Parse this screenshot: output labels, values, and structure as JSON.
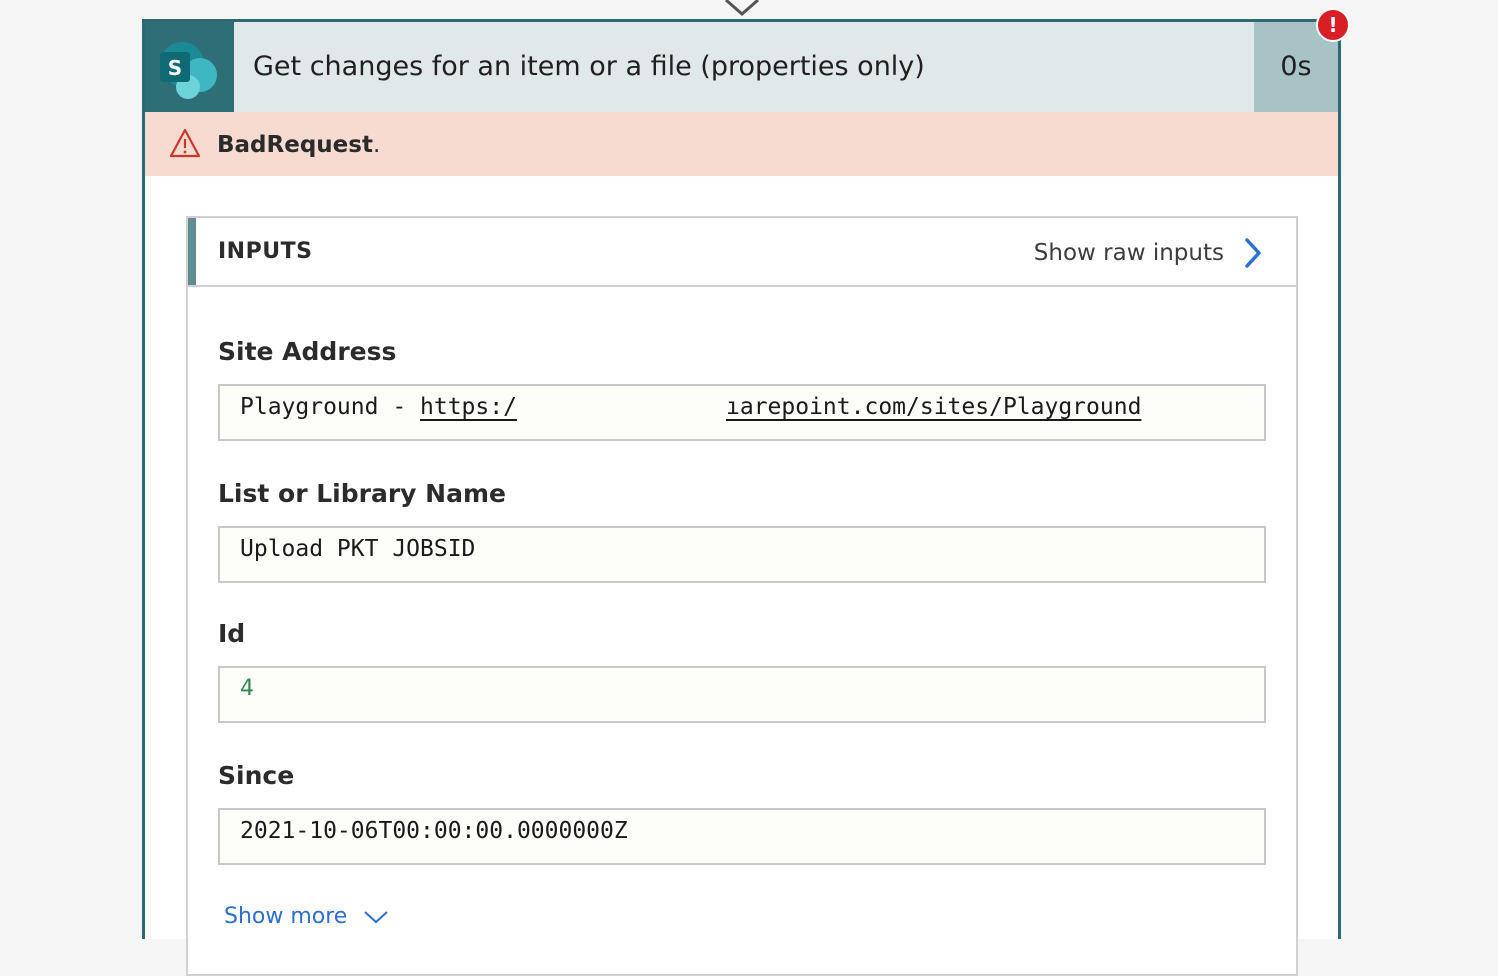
{
  "action": {
    "title": "Get changes for an item or a file (properties only)",
    "duration": "0s",
    "connector_icon": "sharepoint-icon",
    "status_icon": "error-icon",
    "status_glyph": "!"
  },
  "error": {
    "icon": "warning-icon",
    "code": "BadRequest",
    "suffix": "."
  },
  "inputs": {
    "title": "INPUTS",
    "raw_link_label": "Show raw inputs",
    "fields": [
      {
        "label": "Site Address",
        "value_prefix": "Playground - ",
        "value_url_start": "https:/",
        "value_url_end": "ıarepoint.com/sites/Playground"
      },
      {
        "label": "List or Library Name",
        "value": "Upload PKT JOBSID"
      },
      {
        "label": "Id",
        "value": "4"
      },
      {
        "label": "Since",
        "value": "2021-10-06T00:00:00.0000000Z"
      }
    ],
    "show_more_label": "Show more"
  },
  "colors": {
    "card_border": "#2e6a73",
    "header_bg": "#e1e8ea",
    "duration_bg": "#a8c3c6",
    "error_banner_bg": "#f7dad0",
    "error_badge": "#d81f26",
    "link": "#2b6fcf",
    "number_value": "#2f8a4f"
  }
}
